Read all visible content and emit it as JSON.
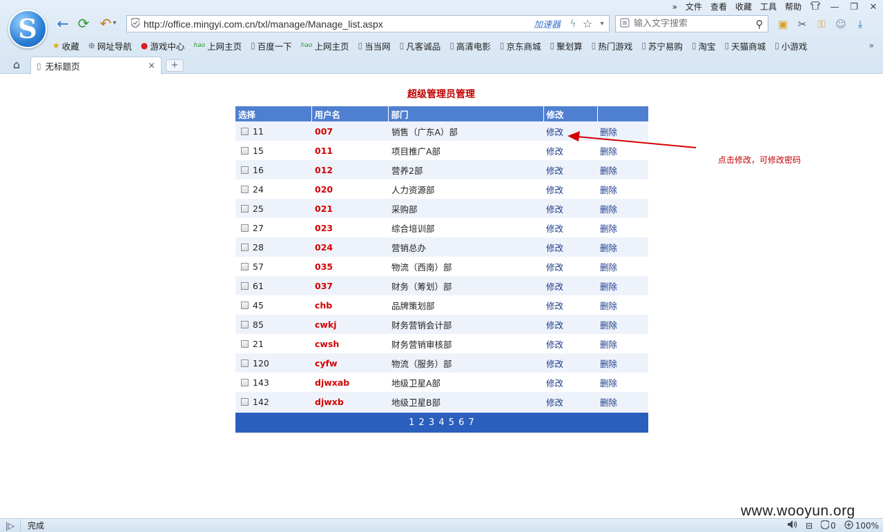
{
  "browser": {
    "menu": {
      "more": "»",
      "items": [
        "文件",
        "查看",
        "收藏",
        "工具",
        "帮助"
      ],
      "skin_icon": "shirt-icon",
      "minimize": "—",
      "restore": "❐",
      "close": "✕"
    },
    "logo_letter": "S",
    "nav": {
      "back": "←",
      "refresh": "⟳",
      "undo": "↶",
      "undo_menu": "▾"
    },
    "address": {
      "url": "http://office.mingyi.com.cn/txl/manage/Manage_list.aspx",
      "accelerator": "加速器",
      "bolt": "ϟ",
      "star": "☆",
      "dropdown": "▾"
    },
    "search": {
      "placeholder": "输入文字搜索",
      "icon": "⚲"
    },
    "tools": [
      "▣",
      "✂",
      "⚿",
      "☺",
      "⤓"
    ],
    "bookmarks": [
      {
        "label": "收藏",
        "icon": "★"
      },
      {
        "label": "网址导航",
        "icon": "⊕"
      },
      {
        "label": "游戏中心",
        "icon": "●"
      },
      {
        "label": "上网主页",
        "icon": "hao"
      },
      {
        "label": "百度一下",
        "icon": "▯"
      },
      {
        "label": "上网主页",
        "icon": "hao"
      },
      {
        "label": "当当网",
        "icon": "▯"
      },
      {
        "label": "凡客诚品",
        "icon": "▯"
      },
      {
        "label": "高清电影",
        "icon": "▯"
      },
      {
        "label": "京东商城",
        "icon": "▯"
      },
      {
        "label": "聚划算",
        "icon": "▯"
      },
      {
        "label": "热门游戏",
        "icon": "▯"
      },
      {
        "label": "苏宁易购",
        "icon": "▯"
      },
      {
        "label": "淘宝",
        "icon": "▯"
      },
      {
        "label": "天猫商城",
        "icon": "▯"
      },
      {
        "label": "小游戏",
        "icon": "▯"
      }
    ],
    "bookmarks_more": "»",
    "home": "⌂",
    "tab": {
      "title": "无标题页",
      "close": "×",
      "page_icon": "▯"
    },
    "newtab": "+"
  },
  "page": {
    "title": "超级管理员管理",
    "columns": [
      "选择",
      "用户名",
      "部门",
      "修改",
      ""
    ],
    "rows": [
      {
        "id": "11",
        "user": "007",
        "dept": "销售（广东A）部",
        "edit": "修改",
        "del": "删除"
      },
      {
        "id": "15",
        "user": "011",
        "dept": "项目推广A部",
        "edit": "修改",
        "del": "删除"
      },
      {
        "id": "16",
        "user": "012",
        "dept": "营养2部",
        "edit": "修改",
        "del": "删除"
      },
      {
        "id": "24",
        "user": "020",
        "dept": "人力资源部",
        "edit": "修改",
        "del": "删除"
      },
      {
        "id": "25",
        "user": "021",
        "dept": "采购部",
        "edit": "修改",
        "del": "删除"
      },
      {
        "id": "27",
        "user": "023",
        "dept": "综合培训部",
        "edit": "修改",
        "del": "删除"
      },
      {
        "id": "28",
        "user": "024",
        "dept": "营销总办",
        "edit": "修改",
        "del": "删除"
      },
      {
        "id": "57",
        "user": "035",
        "dept": "物流（西南）部",
        "edit": "修改",
        "del": "删除"
      },
      {
        "id": "61",
        "user": "037",
        "dept": "财务（筹划）部",
        "edit": "修改",
        "del": "删除"
      },
      {
        "id": "45",
        "user": "chb",
        "dept": "品牌策划部",
        "edit": "修改",
        "del": "删除"
      },
      {
        "id": "85",
        "user": "cwkj",
        "dept": "财务营销会计部",
        "edit": "修改",
        "del": "删除"
      },
      {
        "id": "21",
        "user": "cwsh",
        "dept": "财务营销审核部",
        "edit": "修改",
        "del": "删除"
      },
      {
        "id": "120",
        "user": "cyfw",
        "dept": "物流（服务）部",
        "edit": "修改",
        "del": "删除"
      },
      {
        "id": "143",
        "user": "djwxab",
        "dept": "地级卫星A部",
        "edit": "修改",
        "del": "删除"
      },
      {
        "id": "142",
        "user": "djwxb",
        "dept": "地级卫星B部",
        "edit": "修改",
        "del": "删除"
      }
    ],
    "pager": "1 2 3 4 5 6 7",
    "annotation": "点击修改，可修改密码",
    "annotation_color": "#d40000"
  },
  "watermark": "www.wooyun.org",
  "status": {
    "toggle": "|▷",
    "text": "完成",
    "volume": "🔊",
    "stat_icon": "⊟",
    "block_count": "0",
    "zoom": "100%"
  },
  "colors": {
    "header_bg": "#4f7fd0",
    "pager_bg": "#2a5fbd",
    "accent_red": "#c00000",
    "link_blue": "#1d3d8a"
  }
}
